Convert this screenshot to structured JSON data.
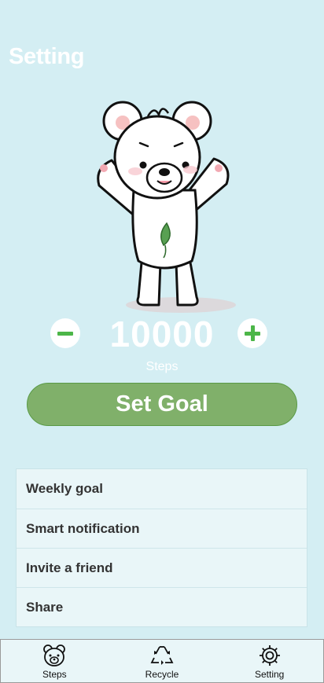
{
  "header": {
    "title": "Setting"
  },
  "goal": {
    "value": "10000",
    "unit": "Steps"
  },
  "actions": {
    "set_goal_label": "Set Goal"
  },
  "settings": {
    "items": [
      {
        "label": "Weekly goal"
      },
      {
        "label": "Smart notification"
      },
      {
        "label": "Invite a friend"
      },
      {
        "label": "Share"
      }
    ]
  },
  "tabs": [
    {
      "label": "Steps",
      "icon": "bear-face-icon"
    },
    {
      "label": "Recycle",
      "icon": "recycle-icon"
    },
    {
      "label": "Setting",
      "icon": "gear-icon"
    }
  ],
  "colors": {
    "background": "#d4eef3",
    "accent_green": "#80b06a",
    "stepper_green": "#4cb648",
    "list_background": "#e9f6f8"
  }
}
